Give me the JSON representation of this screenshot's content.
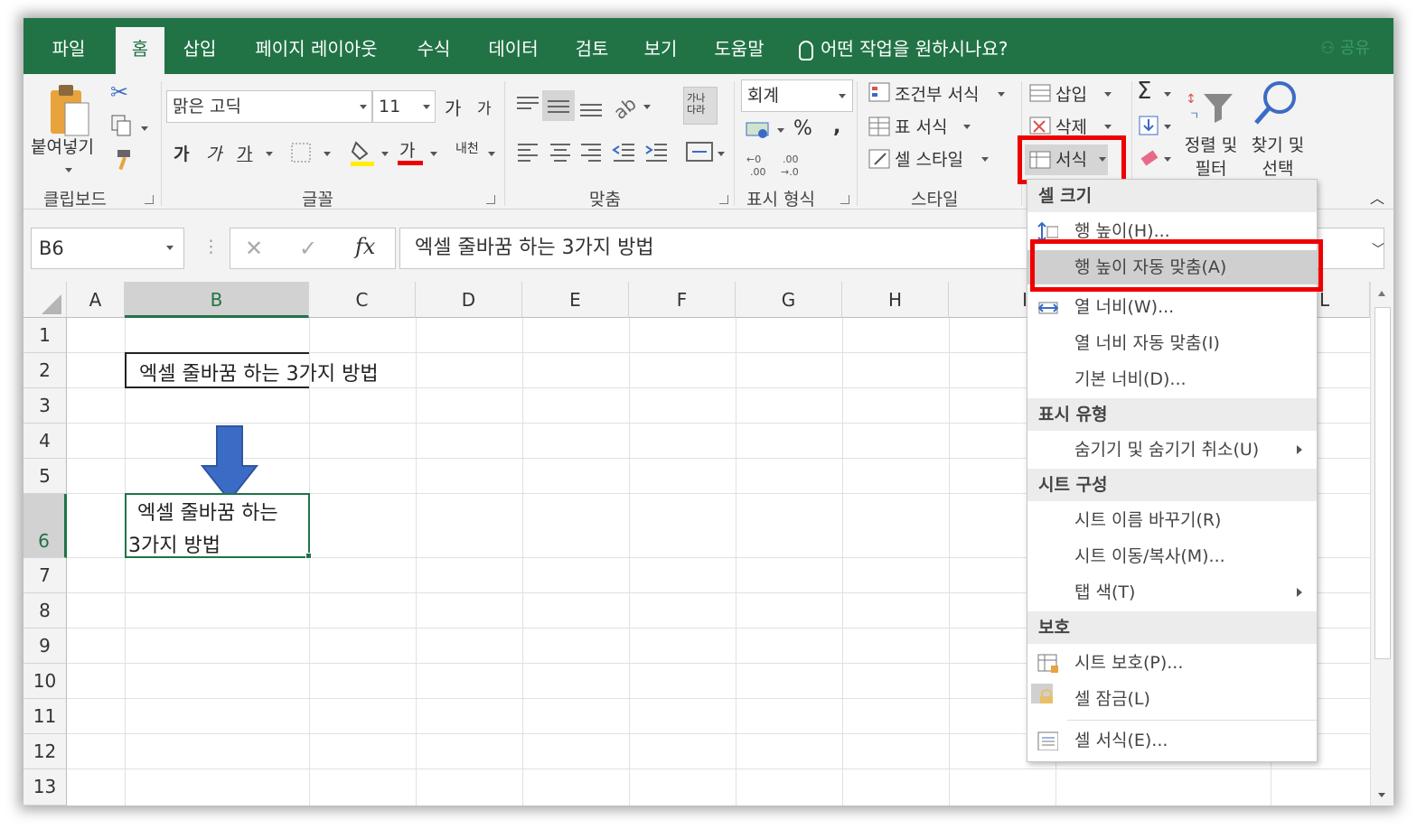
{
  "tabs": [
    "파일",
    "홈",
    "삽입",
    "페이지 레이아웃",
    "수식",
    "데이터",
    "검토",
    "보기",
    "도움말"
  ],
  "active_tab": "홈",
  "tell_me": "어떤 작업을 원하시나요?",
  "share": "공유",
  "ribbon": {
    "clipboard": {
      "paste": "붙여넣기",
      "label": "클립보드"
    },
    "font": {
      "name": "맑은 고딕",
      "size": "11",
      "grow": "가",
      "shrink": "가",
      "bold": "가",
      "italic": "가",
      "underline": "가",
      "color_a": "가",
      "label": "글꼴",
      "phonetic": "내천"
    },
    "align": {
      "label": "맞춤",
      "wrap": "가나다라"
    },
    "number": {
      "format": "회계",
      "percent": "%",
      "comma": ",",
      "label": "표시 형식"
    },
    "styles": {
      "conditional": "조건부 서식",
      "table": "표 서식",
      "cell_style": "셀 스타일",
      "label": "스타일"
    },
    "cells": {
      "insert": "삽입",
      "delete": "삭제",
      "format": "서식"
    },
    "editing": {
      "sort_line1": "정렬 및",
      "sort_line2": "필터",
      "find_line1": "찾기 및",
      "find_line2": "선택",
      "sigma": "Σ"
    }
  },
  "formula_bar": {
    "name_box": "B6",
    "fx": "fx",
    "content": "엑셀 줄바꿈 하는 3가지 방법"
  },
  "columns": [
    "A",
    "B",
    "C",
    "D",
    "E",
    "F",
    "G",
    "H",
    "I",
    "L"
  ],
  "selected_column": "B",
  "rows": [
    "1",
    "2",
    "3",
    "4",
    "5",
    "6",
    "7",
    "8",
    "9",
    "10",
    "11",
    "12",
    "13"
  ],
  "selected_row": "6",
  "cells": {
    "b2": "엑셀 줄바꿈 하는 3가지 방법",
    "b6_line1": "엑셀 줄바꿈 하는",
    "b6_line2": "3가지 방법"
  },
  "menu": {
    "sec_cell_size": "셀 크기",
    "row_height": "행 높이(H)...",
    "autofit_row": "행 높이 자동 맞춤(A)",
    "col_width": "열 너비(W)...",
    "autofit_col": "열 너비 자동 맞춤(I)",
    "default_width": "기본 너비(D)...",
    "sec_visibility": "표시 유형",
    "hide_unhide": "숨기기 및 숨기기 취소(U)",
    "sec_organize": "시트 구성",
    "rename_sheet": "시트 이름 바꾸기(R)",
    "move_copy": "시트 이동/복사(M)...",
    "tab_color": "탭 색(T)",
    "sec_protection": "보호",
    "protect_sheet": "시트 보호(P)...",
    "lock_cell": "셀 잠금(L)",
    "format_cells": "셀 서식(E)..."
  },
  "colors": {
    "excel_green": "#217346",
    "highlight_red": "#ee0000",
    "arrow_blue": "#3b6cc5"
  }
}
